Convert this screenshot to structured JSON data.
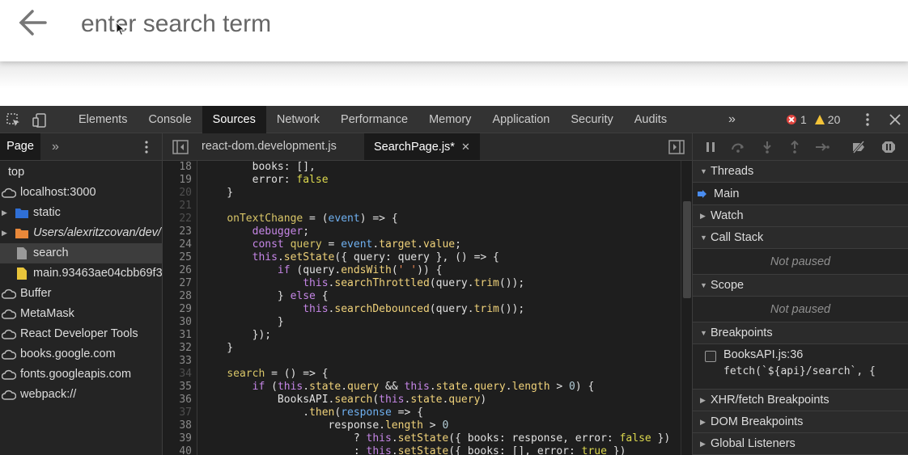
{
  "app": {
    "search_placeholder": "enter search term"
  },
  "devtools": {
    "tabs": [
      "Elements",
      "Console",
      "Sources",
      "Network",
      "Performance",
      "Memory",
      "Application",
      "Security",
      "Audits"
    ],
    "active_tab": "Sources",
    "more_tabs_glyph": "»",
    "error_count": "1",
    "warning_count": "20",
    "left_pane": {
      "tab_label": "Page",
      "more_glyph": "»",
      "tree": [
        {
          "label": "top",
          "icon": "none",
          "indent": 0,
          "italic": false,
          "selected": false
        },
        {
          "label": "localhost:3000",
          "icon": "cloud-icon",
          "indent": 0,
          "italic": false,
          "selected": false
        },
        {
          "label": "static",
          "icon": "folder-icon",
          "color": "#2f6fd6",
          "indent": 1,
          "italic": false,
          "selected": false
        },
        {
          "label": "Users/alexritzcovan/dev/",
          "icon": "folder-icon",
          "color": "#e8883a",
          "indent": 1,
          "italic": true,
          "selected": false
        },
        {
          "label": "search",
          "icon": "file-icon",
          "color": "#9a9a9a",
          "indent": 1,
          "italic": false,
          "selected": true
        },
        {
          "label": "main.93463ae04cbb69f3",
          "icon": "file-icon",
          "color": "#e8c43a",
          "indent": 1,
          "italic": false,
          "selected": false
        },
        {
          "label": "Buffer",
          "icon": "cloud-icon",
          "indent": 0,
          "italic": false,
          "selected": false
        },
        {
          "label": "MetaMask",
          "icon": "cloud-icon",
          "indent": 0,
          "italic": false,
          "selected": false
        },
        {
          "label": "React Developer Tools",
          "icon": "cloud-icon",
          "indent": 0,
          "italic": false,
          "selected": false
        },
        {
          "label": "books.google.com",
          "icon": "cloud-icon",
          "indent": 0,
          "italic": false,
          "selected": false
        },
        {
          "label": "fonts.googleapis.com",
          "icon": "cloud-icon",
          "indent": 0,
          "italic": false,
          "selected": false
        },
        {
          "label": "webpack://",
          "icon": "cloud-icon",
          "indent": 0,
          "italic": false,
          "selected": false
        }
      ]
    },
    "editor": {
      "tabs": [
        {
          "label": "react-dom.development.js",
          "active": false,
          "closable": false
        },
        {
          "label": "SearchPage.js*",
          "active": true,
          "closable": true
        }
      ],
      "close_glyph": "✕",
      "lines": [
        {
          "n": "18",
          "dim": false,
          "code": "        books: [],"
        },
        {
          "n": "19",
          "dim": false,
          "code": "        error: false"
        },
        {
          "n": "20",
          "dim": true,
          "code": "    }"
        },
        {
          "n": "21",
          "dim": true,
          "code": ""
        },
        {
          "n": "22",
          "dim": true,
          "code": "    onTextChange = (event) => {"
        },
        {
          "n": "23",
          "dim": false,
          "code": "        debugger;"
        },
        {
          "n": "24",
          "dim": false,
          "code": "        const query = event.target.value;"
        },
        {
          "n": "25",
          "dim": false,
          "code": "        this.setState({ query: query }, () => {"
        },
        {
          "n": "26",
          "dim": false,
          "code": "            if (query.endsWith(' ')) {"
        },
        {
          "n": "27",
          "dim": false,
          "code": "                this.searchThrottled(query.trim());"
        },
        {
          "n": "28",
          "dim": false,
          "code": "            } else {"
        },
        {
          "n": "29",
          "dim": false,
          "code": "                this.searchDebounced(query.trim());"
        },
        {
          "n": "30",
          "dim": false,
          "code": "            }"
        },
        {
          "n": "31",
          "dim": false,
          "code": "        });"
        },
        {
          "n": "32",
          "dim": false,
          "code": "    }"
        },
        {
          "n": "33",
          "dim": false,
          "code": ""
        },
        {
          "n": "34",
          "dim": true,
          "code": "    search = () => {"
        },
        {
          "n": "35",
          "dim": false,
          "code": "        if (this.state.query && this.state.query.length > 0) {"
        },
        {
          "n": "36",
          "dim": false,
          "code": "            BooksAPI.search(this.state.query)"
        },
        {
          "n": "37",
          "dim": true,
          "code": "                .then(response => {"
        },
        {
          "n": "38",
          "dim": false,
          "code": "                    response.length > 0"
        },
        {
          "n": "39",
          "dim": false,
          "code": "                        ? this.setState({ books: response, error: false })"
        },
        {
          "n": "40",
          "dim": false,
          "code": "                        : this.setState({ books: [], error: true })"
        }
      ]
    },
    "right_pane": {
      "sections": {
        "threads": "Threads",
        "thread_main": "Main",
        "watch": "Watch",
        "call_stack": "Call Stack",
        "call_stack_status": "Not paused",
        "scope": "Scope",
        "scope_status": "Not paused",
        "breakpoints": "Breakpoints",
        "breakpoint_file": "BooksAPI.js:36",
        "breakpoint_code": "fetch(`${api}/search`, {",
        "xhr": "XHR/fetch Breakpoints",
        "dom": "DOM Breakpoints",
        "global": "Global Listeners"
      }
    }
  }
}
